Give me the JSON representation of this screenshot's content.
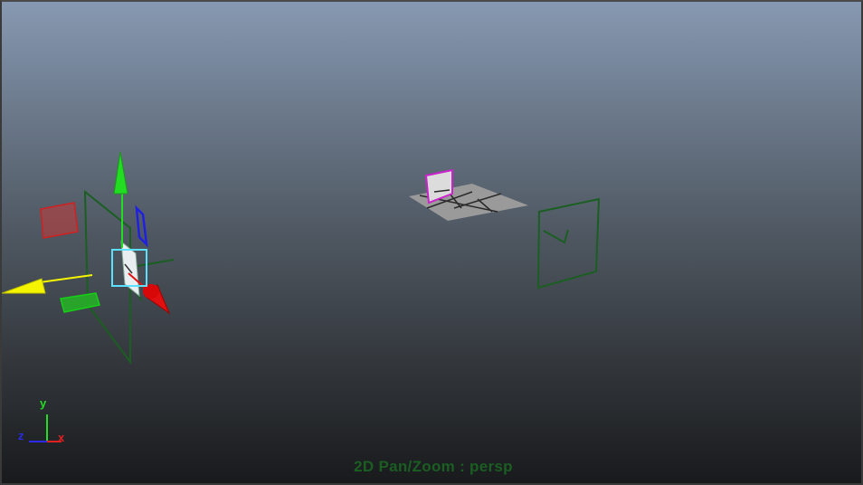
{
  "viewport": {
    "camera": "persp",
    "mode_label": "2D Pan/Zoom : persp",
    "background_top": "#8799b2",
    "background_bottom": "#181a1c"
  },
  "axis_indicator": {
    "y_label": "y",
    "x_label": "x",
    "z_label": "z",
    "colors": {
      "x": "#e02020",
      "y": "#22dd22",
      "z": "#2a2ae8"
    }
  },
  "manipulator": {
    "icon": "move-manipulator-icon",
    "colors": {
      "x": "#e01010",
      "y": "#22dd22",
      "z": "#2020e0",
      "center": "#5ce0ff",
      "yellow": "#f5f500"
    }
  },
  "scene_objects": [
    {
      "name": "camera-wireframe-left",
      "color": "#1b5e22"
    },
    {
      "name": "image-plane-textured",
      "color": "#9a9a9a",
      "highlight": "#cc22cc"
    },
    {
      "name": "camera-wireframe-right",
      "color": "#1b5e22"
    }
  ]
}
